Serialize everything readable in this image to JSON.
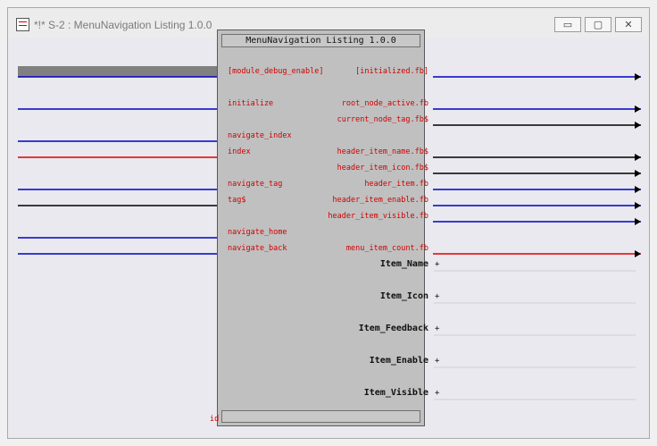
{
  "window": {
    "title": "*!* S-2 : MenuNavigation Listing 1.0.0",
    "minimize_glyph": "▭",
    "maximize_glyph": "▢",
    "close_glyph": "✕"
  },
  "block": {
    "title": "MenuNavigation Listing 1.0.0",
    "id_label": "id"
  },
  "inputs": [
    {
      "label": "[module_debug_enable]",
      "signal": "digital"
    },
    {
      "label": "initialize",
      "signal": "digital"
    },
    {
      "label": "navigate_index",
      "signal": "digital"
    },
    {
      "label": "index",
      "signal": "analog"
    },
    {
      "label": "navigate_tag",
      "signal": "digital"
    },
    {
      "label": "tag$",
      "signal": "serial"
    },
    {
      "label": "navigate_home",
      "signal": "digital"
    },
    {
      "label": "navigate_back",
      "signal": "digital"
    }
  ],
  "outputs": [
    {
      "label": "[initialized.fb]",
      "signal": "digital"
    },
    {
      "label": "root_node_active.fb",
      "signal": "digital"
    },
    {
      "label": "current_node_tag.fb$",
      "signal": "serial"
    },
    {
      "label": "header_item_name.fb$",
      "signal": "serial"
    },
    {
      "label": "header_item_icon.fb$",
      "signal": "serial"
    },
    {
      "label": "header_item.fb",
      "signal": "digital"
    },
    {
      "label": "header_item_enable.fb",
      "signal": "digital"
    },
    {
      "label": "header_item_visible.fb",
      "signal": "digital"
    },
    {
      "label": "menu_item_count.fb",
      "signal": "analog"
    }
  ],
  "groups": [
    {
      "label": "Item_Name",
      "plus": "+"
    },
    {
      "label": "Item_Icon",
      "plus": "+"
    },
    {
      "label": "Item_Feedback",
      "plus": "+"
    },
    {
      "label": "Item_Enable",
      "plus": "+"
    },
    {
      "label": "Item_Visible",
      "plus": "+"
    }
  ],
  "colors": {
    "digital": "#0000c8",
    "analog": "#e00000",
    "serial": "#000000",
    "label": "#d00000"
  }
}
